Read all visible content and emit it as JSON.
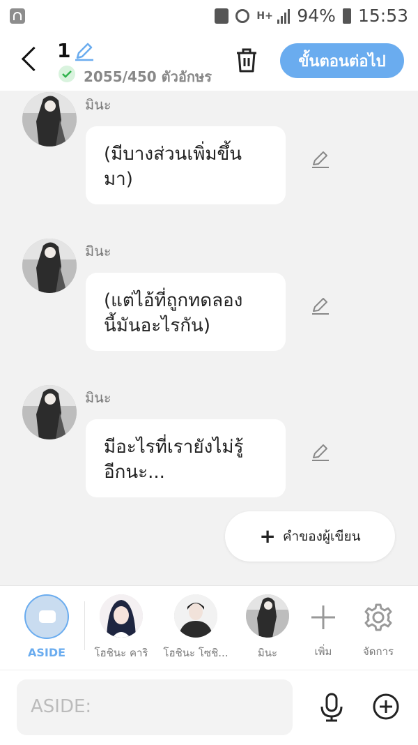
{
  "status_bar": {
    "battery": "94%",
    "time": "15:53",
    "network": "H+"
  },
  "header": {
    "episode_number": "1",
    "char_count": "2055/450 ตัวอักษร",
    "next_button": "ขั้นตอนต่อไป"
  },
  "messages": [
    {
      "sender": "มินะ",
      "text_line1": "(มีบางส่วนเพิ่มขึ้น",
      "text_line2": "มา)"
    },
    {
      "sender": "มินะ",
      "text_line1": "(แต่ไอ้ที่ถูกทดลอง",
      "text_line2": "นี้มันอะไรกัน)"
    },
    {
      "sender": "มินะ",
      "text_line1": "มีอะไรที่เรายังไม่รู้",
      "text_line2": "อีกนะ..."
    }
  ],
  "author_note_button": "คำของผู้เขียน",
  "characters": [
    {
      "label": "ASIDE"
    },
    {
      "label": "โฮชินะ คาริ"
    },
    {
      "label": "โฮชินะ โซชิ..."
    },
    {
      "label": "มินะ"
    }
  ],
  "tools": {
    "add_label": "เพิ่ม",
    "manage_label": "จัดการ"
  },
  "input": {
    "placeholder": "ASIDE:"
  },
  "colors": {
    "accent": "#6aacef",
    "check_green": "#2fb24c"
  }
}
